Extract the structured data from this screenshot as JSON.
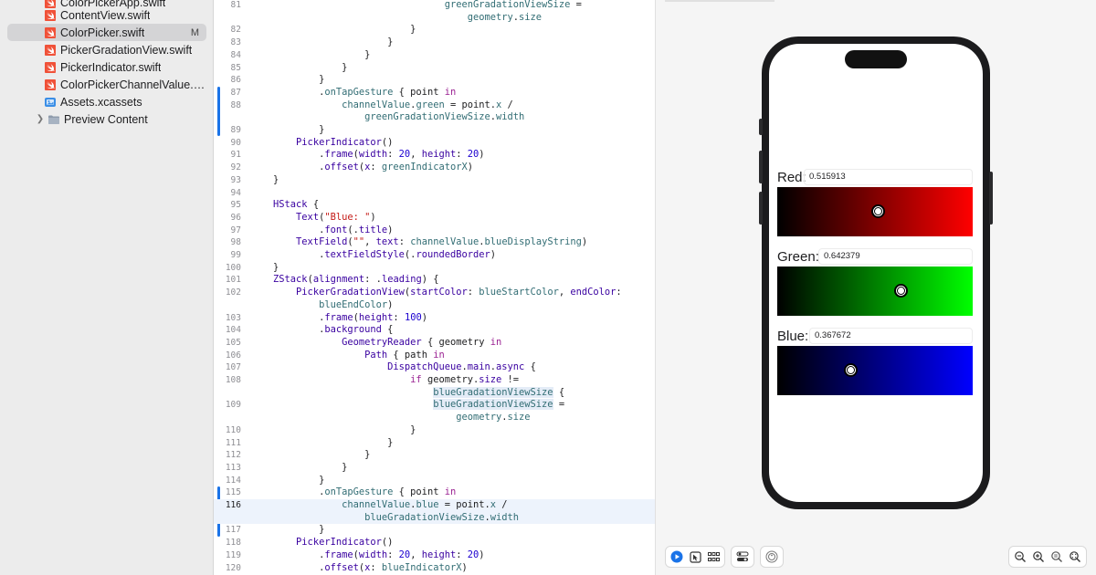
{
  "sidebar": {
    "files": [
      {
        "name": "ColorPickerApp.swift",
        "icon": "swift-file-icon",
        "selected": false,
        "badge": ""
      },
      {
        "name": "ContentView.swift",
        "icon": "swift-file-icon",
        "selected": false,
        "badge": ""
      },
      {
        "name": "ColorPicker.swift",
        "icon": "swift-file-icon",
        "selected": true,
        "badge": "M"
      },
      {
        "name": "PickerGradationView.swift",
        "icon": "swift-file-icon",
        "selected": false,
        "badge": ""
      },
      {
        "name": "PickerIndicator.swift",
        "icon": "swift-file-icon",
        "selected": false,
        "badge": ""
      },
      {
        "name": "ColorPickerChannelValue.s...",
        "icon": "swift-file-icon",
        "selected": false,
        "badge": ""
      },
      {
        "name": "Assets.xcassets",
        "icon": "asset-catalog-icon",
        "selected": false,
        "badge": ""
      },
      {
        "name": "Preview Content",
        "icon": "folder-icon",
        "selected": false,
        "badge": ""
      }
    ]
  },
  "editor": {
    "current_line": "116",
    "lines": [
      {
        "n": "81",
        "html": "                                  <span class=\"pr\">greenGradationViewSize</span> ="
      },
      {
        "n": "",
        "html": "                                      <span class=\"pr\">geometry</span>.<span class=\"pr\">size</span>"
      },
      {
        "n": "82",
        "html": "                            }"
      },
      {
        "n": "83",
        "html": "                        }"
      },
      {
        "n": "84",
        "html": "                    }"
      },
      {
        "n": "85",
        "html": "                }"
      },
      {
        "n": "86",
        "html": "            }"
      },
      {
        "n": "87",
        "html": "            .<span class=\"pr\">onTapGesture</span> { point <span class=\"kw\">in</span>"
      },
      {
        "n": "88",
        "html": "                <span class=\"pr\">channelValue</span>.<span class=\"pr\">green</span> = point.<span class=\"pr\">x</span> /"
      },
      {
        "n": "",
        "html": "                    <span class=\"pr\">greenGradationViewSize</span>.<span class=\"pr\">width</span>"
      },
      {
        "n": "89",
        "html": "            }"
      },
      {
        "n": "90",
        "html": "        <span class=\"ty\">PickerIndicator</span>()"
      },
      {
        "n": "91",
        "html": "            .<span class=\"ty\">frame</span>(<span class=\"ty\">width</span>: <span class=\"num\">20</span>, <span class=\"ty\">height</span>: <span class=\"num\">20</span>)"
      },
      {
        "n": "92",
        "html": "            .<span class=\"ty\">offset</span>(<span class=\"ty\">x</span>: <span class=\"pr\">greenIndicatorX</span>)"
      },
      {
        "n": "93",
        "html": "    }"
      },
      {
        "n": "94",
        "html": ""
      },
      {
        "n": "95",
        "html": "    <span class=\"ty\">HStack</span> {"
      },
      {
        "n": "96",
        "html": "        <span class=\"ty\">Text</span>(<span class=\"str\">\"Blue: \"</span>)"
      },
      {
        "n": "97",
        "html": "            .<span class=\"ty\">font</span>(.<span class=\"ty\">title</span>)"
      },
      {
        "n": "98",
        "html": "        <span class=\"ty\">TextField</span>(<span class=\"str\">\"\"</span>, <span class=\"ty\">text</span>: <span class=\"pr\">channelValue</span>.<span class=\"pr\">blueDisplayString</span>)"
      },
      {
        "n": "99",
        "html": "            .<span class=\"ty\">textFieldStyle</span>(.<span class=\"ty\">roundedBorder</span>)"
      },
      {
        "n": "100",
        "html": "    }"
      },
      {
        "n": "101",
        "html": "    <span class=\"ty\">ZStack</span>(<span class=\"ty\">alignment</span>: .<span class=\"ty\">leading</span>) {"
      },
      {
        "n": "102",
        "html": "        <span class=\"ty\">PickerGradationView</span>(<span class=\"ty\">startColor</span>: <span class=\"pr\">blueStartColor</span>, <span class=\"ty\">endColor</span>:"
      },
      {
        "n": "",
        "html": "            <span class=\"pr\">blueEndColor</span>)"
      },
      {
        "n": "103",
        "html": "            .<span class=\"ty\">frame</span>(<span class=\"ty\">height</span>: <span class=\"num\">100</span>)"
      },
      {
        "n": "104",
        "html": "            .<span class=\"ty\">background</span> {"
      },
      {
        "n": "105",
        "html": "                <span class=\"ty\">GeometryReader</span> { geometry <span class=\"kw\">in</span>"
      },
      {
        "n": "106",
        "html": "                    <span class=\"ty\">Path</span> { path <span class=\"kw\">in</span>"
      },
      {
        "n": "107",
        "html": "                        <span class=\"ty\">DispatchQueue</span>.<span class=\"ty\">main</span>.<span class=\"ty\">async</span> {"
      },
      {
        "n": "108",
        "html": "                            <span class=\"kw\">if</span> geometry.<span class=\"ty\">size</span> !="
      },
      {
        "n": "",
        "html": "                                <span class=\"pr hl\">blueGradationViewSize</span> {"
      },
      {
        "n": "109",
        "html": "                                <span class=\"pr hl\">blueGradationViewSize</span> ="
      },
      {
        "n": "",
        "html": "                                    <span class=\"pr\">geometry</span>.<span class=\"pr\">size</span>"
      },
      {
        "n": "110",
        "html": "                            }"
      },
      {
        "n": "111",
        "html": "                        }"
      },
      {
        "n": "112",
        "html": "                    }"
      },
      {
        "n": "113",
        "html": "                }"
      },
      {
        "n": "114",
        "html": "            }"
      },
      {
        "n": "115",
        "html": "            .<span class=\"pr\">onTapGesture</span> { point <span class=\"kw\">in</span>"
      },
      {
        "n": "116",
        "html": "                <span class=\"pr\">channelValue</span>.<span class=\"pr\">blue</span> = point.<span class=\"pr\">x</span> /"
      },
      {
        "n": "",
        "html": "                    <span class=\"pr\">blueGradationViewSize</span>.<span class=\"pr\">width</span>"
      },
      {
        "n": "117",
        "html": "            }"
      },
      {
        "n": "118",
        "html": "        <span class=\"ty\">PickerIndicator</span>()"
      },
      {
        "n": "119",
        "html": "            .<span class=\"ty\">frame</span>(<span class=\"ty\">width</span>: <span class=\"num\">20</span>, <span class=\"ty\">height</span>: <span class=\"num\">20</span>)"
      },
      {
        "n": "120",
        "html": "            .<span class=\"ty\">offset</span>(<span class=\"ty\">x</span>: <span class=\"pr\">blueIndicatorX</span>)"
      }
    ]
  },
  "preview": {
    "channels": [
      {
        "key": "red",
        "label": "Red:",
        "value": "0.515913",
        "level": 0.515913
      },
      {
        "key": "green",
        "label": "Green:",
        "value": "0.642379",
        "level": 0.642379
      },
      {
        "key": "blue",
        "label": "Blue:",
        "value": "0.367672",
        "level": 0.367672
      }
    ]
  },
  "toolbar": {
    "left_buttons": [
      "play-icon",
      "selectable-icon",
      "variants-grid-icon",
      "device-settings-icon",
      "accessibility-icon"
    ],
    "zoom_buttons": [
      "zoom-out-icon",
      "zoom-in-icon",
      "zoom-100-icon",
      "zoom-fit-icon"
    ]
  },
  "colors": {
    "swift_orange": "#f05138",
    "accent_blue": "#1a73e8"
  }
}
